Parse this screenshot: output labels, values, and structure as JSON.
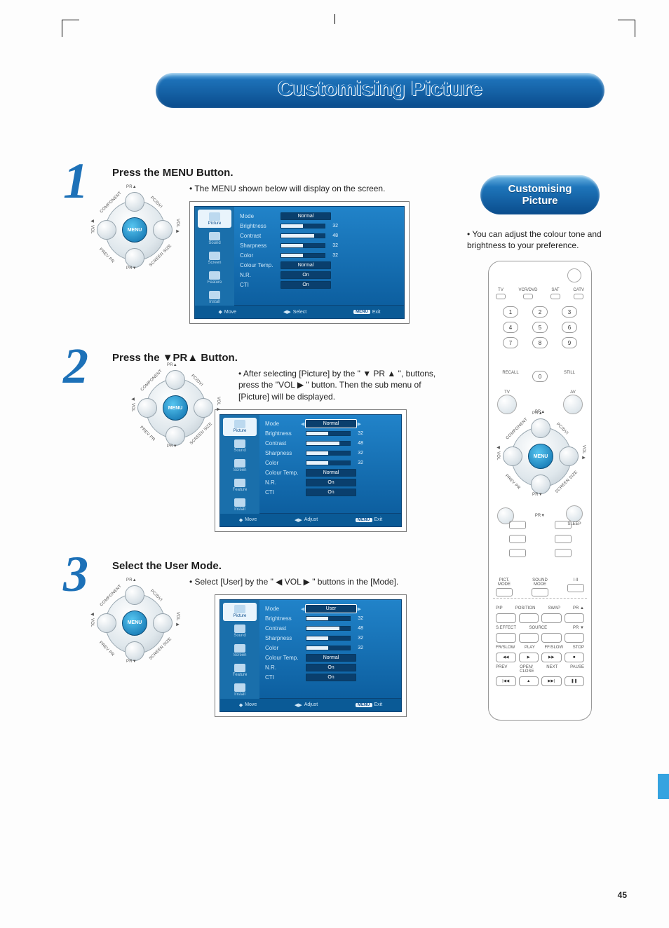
{
  "page_number": "45",
  "title": "Customising Picture",
  "right": {
    "pill_line1": "Customising",
    "pill_line2": "Picture",
    "intro": "• You can adjust the colour tone and brightness to your preference."
  },
  "dpad": {
    "center": "MENU",
    "top": "PR▲",
    "bottom": "PR▼",
    "ul": "COMPONENT",
    "ur": "PC/DVI",
    "dl": "PREV PR",
    "dr": "SCREEN SIZE",
    "side_l": "◀ VOL",
    "side_r": "VOL ▶"
  },
  "osd_side": [
    "Picture",
    "Sound",
    "Screen",
    "Feature",
    "Install"
  ],
  "osd_foot": {
    "move": "Move",
    "select": "Select",
    "adjust": "Adjust",
    "exit": "Exit",
    "menu": "MENU"
  },
  "steps": [
    {
      "num": "1",
      "heading": "Press the MENU Button.",
      "text": "• The MENU shown below will display on the screen.",
      "osd": {
        "selected_side": 0,
        "rows": [
          {
            "label": "Mode",
            "type": "pill",
            "value": "Normal",
            "sel": false
          },
          {
            "label": "Brightness",
            "type": "slider",
            "value": "32",
            "fill": 50
          },
          {
            "label": "Contrast",
            "type": "slider",
            "value": "48",
            "fill": 75
          },
          {
            "label": "Sharpness",
            "type": "slider",
            "value": "32",
            "fill": 50
          },
          {
            "label": "Color",
            "type": "slider",
            "value": "32",
            "fill": 50
          },
          {
            "label": "Colour Temp.",
            "type": "pill",
            "value": "Normal",
            "sel": false
          },
          {
            "label": "N.R.",
            "type": "pill",
            "value": "On",
            "sel": false
          },
          {
            "label": "CTI",
            "type": "pill",
            "value": "On",
            "sel": false
          }
        ],
        "foot_mid": "Select"
      }
    },
    {
      "num": "2",
      "heading": "Press the ▼PR▲ Button.",
      "text": "• After selecting [Picture] by the \" ▼ PR ▲ \", buttons, press the  \"VOL ▶ \" button. Then the sub menu of [Picture] will be displayed.",
      "osd": {
        "selected_side": 0,
        "rows": [
          {
            "label": "Mode",
            "type": "pill",
            "value": "Normal",
            "sel": true,
            "arrows": true
          },
          {
            "label": "Brightness",
            "type": "slider",
            "value": "32",
            "fill": 50
          },
          {
            "label": "Contrast",
            "type": "slider",
            "value": "48",
            "fill": 75
          },
          {
            "label": "Sharpness",
            "type": "slider",
            "value": "32",
            "fill": 50
          },
          {
            "label": "Color",
            "type": "slider",
            "value": "32",
            "fill": 50
          },
          {
            "label": "Colour Temp.",
            "type": "pill",
            "value": "Normal",
            "sel": false
          },
          {
            "label": "N.R.",
            "type": "pill",
            "value": "On",
            "sel": false
          },
          {
            "label": "CTI",
            "type": "pill",
            "value": "On",
            "sel": false
          }
        ],
        "foot_mid": "Adjust"
      }
    },
    {
      "num": "3",
      "heading": "Select the User Mode.",
      "text": "• Select [User] by the \" ◀ VOL ▶ \" buttons in the [Mode].",
      "osd": {
        "selected_side": 0,
        "rows": [
          {
            "label": "Mode",
            "type": "pill",
            "value": "User",
            "sel": true,
            "arrows": true
          },
          {
            "label": "Brightness",
            "type": "slider",
            "value": "32",
            "fill": 50
          },
          {
            "label": "Contrast",
            "type": "slider",
            "value": "48",
            "fill": 75
          },
          {
            "label": "Sharpness",
            "type": "slider",
            "value": "32",
            "fill": 50
          },
          {
            "label": "Color",
            "type": "slider",
            "value": "32",
            "fill": 50
          },
          {
            "label": "Colour Temp.",
            "type": "pill",
            "value": "Normal",
            "sel": false
          },
          {
            "label": "N.R.",
            "type": "pill",
            "value": "On",
            "sel": false
          },
          {
            "label": "CTI",
            "type": "pill",
            "value": "On",
            "sel": false
          }
        ],
        "foot_mid": "Adjust"
      }
    }
  ],
  "remote": {
    "sources": [
      "TV",
      "VCR/DVD",
      "SAT",
      "CATV"
    ],
    "numbers": [
      "1",
      "2",
      "3",
      "4",
      "5",
      "6",
      "7",
      "8",
      "9"
    ],
    "recall": "RECALL",
    "still": "STILL",
    "zero": "0",
    "tv": "TV",
    "av": "AV",
    "pr_up": "PR▲",
    "pr_dn": "PR▼",
    "sleep": "SLEEP",
    "pict": "PICT.\nMODE",
    "sound": "SOUND\nMODE",
    "iii": "I·II",
    "row_top": [
      "PIP",
      "POSITION",
      "SWAP",
      "PR ▲"
    ],
    "row_2": [
      "S.EFFECT",
      "SOURCE",
      "",
      "PR ▼"
    ],
    "transport1": [
      "FR/SLOW",
      "PLAY",
      "FF/SLOW",
      "STOP"
    ],
    "transport1_sym": [
      "◀◀",
      "▶",
      "▶▶",
      "■"
    ],
    "transport2": [
      "PREV",
      "OPEN/\nCLOSE",
      "NEXT",
      "PAUSE"
    ],
    "transport2_sym": [
      "|◀◀",
      "▲",
      "▶▶|",
      "❚❚"
    ]
  }
}
